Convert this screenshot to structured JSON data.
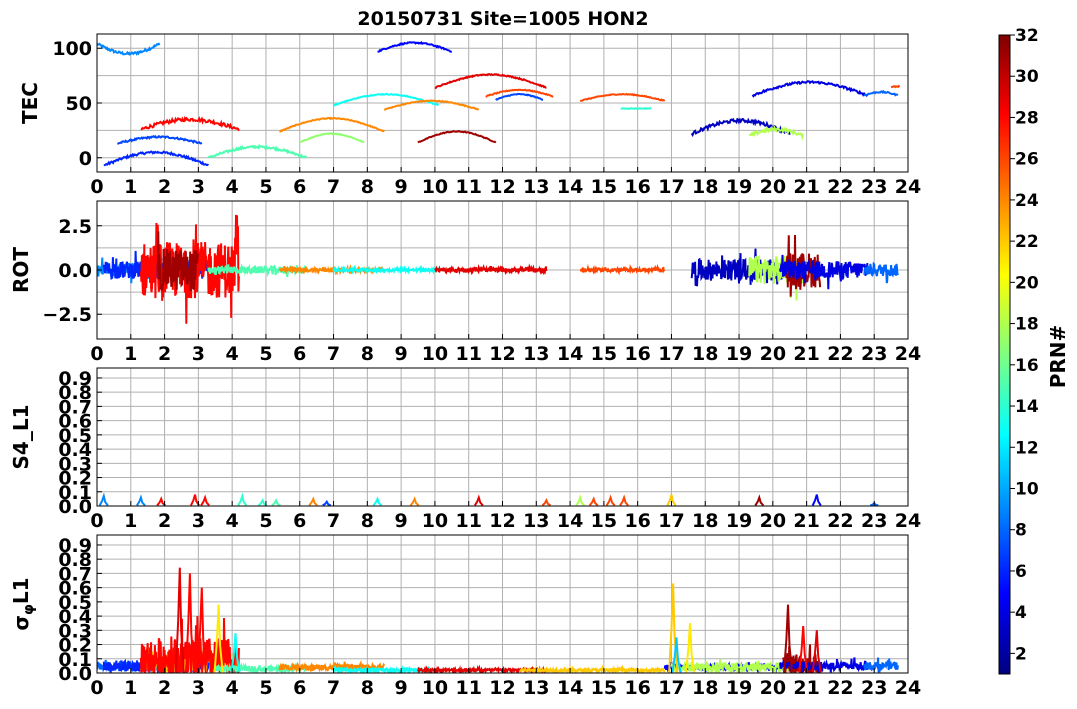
{
  "chart_data": {
    "type": "line",
    "title": "20150731 Site=1005 HON2",
    "x_ticks": [
      "0",
      "1",
      "2",
      "3",
      "4",
      "5",
      "6",
      "7",
      "8",
      "9",
      "10",
      "11",
      "12",
      "13",
      "14",
      "15",
      "16",
      "17",
      "18",
      "19",
      "20",
      "21",
      "22",
      "23",
      "24"
    ],
    "xlim": [
      0,
      24
    ],
    "grid": true,
    "colorbar": {
      "label": "PRN#",
      "range": [
        1,
        32
      ],
      "ticks": [
        "2",
        "4",
        "6",
        "8",
        "10",
        "12",
        "14",
        "16",
        "18",
        "20",
        "22",
        "24",
        "26",
        "28",
        "30",
        "32"
      ],
      "colors": [
        "#00007f",
        "#0000ff",
        "#007fff",
        "#00ffff",
        "#7fff7f",
        "#ffff00",
        "#ff7f00",
        "#ff0000",
        "#7f0000"
      ]
    },
    "panels": [
      {
        "ylabel": "TEC",
        "ylim": [
          -13,
          113
        ],
        "y_ticks": [
          {
            "v": 0,
            "t": "0"
          },
          {
            "v": 50,
            "t": "50"
          },
          {
            "v": 100,
            "t": "100"
          }
        ],
        "y_grid": [
          0,
          25,
          50,
          75,
          100
        ],
        "arcs": [
          {
            "prn": 9,
            "x0": 0.0,
            "x1": 1.85,
            "amp": -9,
            "base": 104,
            "noise": 1.2
          },
          {
            "prn": 6,
            "x0": 0.2,
            "x1": 3.3,
            "amp": 12,
            "base": -7,
            "noise": 1.0
          },
          {
            "prn": 7,
            "x0": 0.6,
            "x1": 3.1,
            "amp": 6,
            "base": 13,
            "noise": 0.8
          },
          {
            "prn": 28,
            "x0": 1.3,
            "x1": 4.2,
            "amp": 9,
            "base": 26,
            "noise": 1.5
          },
          {
            "prn": 15,
            "x0": 3.3,
            "x1": 6.2,
            "amp": 10,
            "base": 0,
            "noise": 1.0
          },
          {
            "prn": 24,
            "x0": 5.4,
            "x1": 8.5,
            "amp": 12,
            "base": 24,
            "noise": 0.4
          },
          {
            "prn": 17,
            "x0": 6.0,
            "x1": 7.9,
            "amp": 8,
            "base": 14,
            "noise": 0.4
          },
          {
            "prn": 13,
            "x0": 7.0,
            "x1": 10.1,
            "amp": 10,
            "base": 48,
            "noise": 0.4
          },
          {
            "prn": 5,
            "x0": 8.3,
            "x1": 10.5,
            "amp": 8,
            "base": 97,
            "noise": 0.6
          },
          {
            "prn": 24,
            "x0": 8.5,
            "x1": 11.3,
            "amp": 8,
            "base": 44,
            "noise": 0.4
          },
          {
            "prn": 31,
            "x0": 9.5,
            "x1": 11.8,
            "amp": 10,
            "base": 14,
            "noise": 0.4
          },
          {
            "prn": 29,
            "x0": 10.0,
            "x1": 13.3,
            "amp": 12,
            "base": 64,
            "noise": 0.5
          },
          {
            "prn": 26,
            "x0": 11.5,
            "x1": 13.5,
            "amp": 6,
            "base": 56,
            "noise": 0.4
          },
          {
            "prn": 7,
            "x0": 11.8,
            "x1": 13.2,
            "amp": 5,
            "base": 53,
            "noise": 0.4
          },
          {
            "prn": 26,
            "x0": 14.3,
            "x1": 16.8,
            "amp": 6,
            "base": 52,
            "noise": 0.4
          },
          {
            "prn": 14,
            "x0": 15.5,
            "x1": 16.4,
            "amp": 0,
            "base": 45,
            "noise": 0.3
          },
          {
            "prn": 3,
            "x0": 17.6,
            "x1": 20.5,
            "amp": 12,
            "base": 22,
            "noise": 1.5
          },
          {
            "prn": 18,
            "x0": 19.3,
            "x1": 20.9,
            "amp": 6,
            "base": 20,
            "noise": 1.5
          },
          {
            "prn": 4,
            "x0": 19.4,
            "x1": 22.8,
            "amp": 12,
            "base": 57,
            "noise": 1.0
          },
          {
            "prn": 8,
            "x0": 22.7,
            "x1": 23.7,
            "amp": 3,
            "base": 57,
            "noise": 0.6
          },
          {
            "prn": 26,
            "x0": 23.5,
            "x1": 23.75,
            "amp": 0,
            "base": 65,
            "noise": 0.5
          }
        ]
      },
      {
        "ylabel": "ROT",
        "ylim": [
          -3.9,
          3.9
        ],
        "y_ticks": [
          {
            "v": -2.5,
            "t": "−2.5"
          },
          {
            "v": 0,
            "t": "0.0"
          },
          {
            "v": 2.5,
            "t": "2.5"
          }
        ],
        "y_grid": [
          -2.5,
          -1.25,
          0,
          1.25,
          2.5
        ],
        "arcs": [
          {
            "prn": 9,
            "x0": 0.0,
            "x1": 1.9,
            "noise": 0.35
          },
          {
            "prn": 6,
            "x0": 0.2,
            "x1": 3.3,
            "noise": 0.5
          },
          {
            "prn": 28,
            "x0": 1.3,
            "x1": 4.2,
            "noise": 1.6
          },
          {
            "prn": 31,
            "x0": 1.8,
            "x1": 3.0,
            "noise": 1.2
          },
          {
            "prn": 15,
            "x0": 3.3,
            "x1": 6.2,
            "noise": 0.2
          },
          {
            "prn": 24,
            "x0": 5.4,
            "x1": 8.5,
            "noise": 0.1
          },
          {
            "prn": 13,
            "x0": 7.0,
            "x1": 10.1,
            "noise": 0.08
          },
          {
            "prn": 29,
            "x0": 10.0,
            "x1": 13.3,
            "noise": 0.1
          },
          {
            "prn": 26,
            "x0": 14.3,
            "x1": 16.8,
            "noise": 0.08
          },
          {
            "prn": 3,
            "x0": 17.6,
            "x1": 20.5,
            "noise": 0.6
          },
          {
            "prn": 18,
            "x0": 19.3,
            "x1": 20.9,
            "noise": 0.8
          },
          {
            "prn": 31,
            "x0": 20.4,
            "x1": 21.4,
            "noise": 1.0
          },
          {
            "prn": 4,
            "x0": 20.2,
            "x1": 22.8,
            "noise": 0.5
          },
          {
            "prn": 8,
            "x0": 22.7,
            "x1": 23.7,
            "noise": 0.35
          }
        ]
      },
      {
        "ylabel": "S4_L1",
        "ylim": [
          0,
          0.97
        ],
        "y_ticks": [
          {
            "v": 0,
            "t": "0.0"
          },
          {
            "v": 0.1,
            "t": "0.1"
          },
          {
            "v": 0.2,
            "t": "0.2"
          },
          {
            "v": 0.3,
            "t": "0.3"
          },
          {
            "v": 0.4,
            "t": "0.4"
          },
          {
            "v": 0.5,
            "t": "0.5"
          },
          {
            "v": 0.6,
            "t": "0.6"
          },
          {
            "v": 0.7,
            "t": "0.7"
          },
          {
            "v": 0.8,
            "t": "0.8"
          },
          {
            "v": 0.9,
            "t": "0.9"
          }
        ],
        "y_grid": [
          0.1,
          0.2,
          0.3,
          0.4,
          0.5,
          0.6,
          0.7,
          0.8,
          0.9
        ],
        "spikes": [
          {
            "prn": 9,
            "x": 0.2,
            "v": 0.07
          },
          {
            "prn": 9,
            "x": 1.3,
            "v": 0.06
          },
          {
            "prn": 28,
            "x": 1.9,
            "v": 0.05
          },
          {
            "prn": 28,
            "x": 2.9,
            "v": 0.08
          },
          {
            "prn": 28,
            "x": 3.2,
            "v": 0.06
          },
          {
            "prn": 14,
            "x": 4.3,
            "v": 0.07
          },
          {
            "prn": 14,
            "x": 4.9,
            "v": 0.04
          },
          {
            "prn": 15,
            "x": 5.3,
            "v": 0.04
          },
          {
            "prn": 24,
            "x": 6.4,
            "v": 0.05
          },
          {
            "prn": 7,
            "x": 6.8,
            "v": 0.03
          },
          {
            "prn": 13,
            "x": 8.3,
            "v": 0.05
          },
          {
            "prn": 24,
            "x": 9.4,
            "v": 0.05
          },
          {
            "prn": 29,
            "x": 11.3,
            "v": 0.06
          },
          {
            "prn": 26,
            "x": 13.3,
            "v": 0.04
          },
          {
            "prn": 18,
            "x": 14.3,
            "v": 0.06
          },
          {
            "prn": 26,
            "x": 14.7,
            "v": 0.05
          },
          {
            "prn": 26,
            "x": 15.2,
            "v": 0.06
          },
          {
            "prn": 26,
            "x": 15.6,
            "v": 0.06
          },
          {
            "prn": 22,
            "x": 17.0,
            "v": 0.08
          },
          {
            "prn": 31,
            "x": 19.6,
            "v": 0.06
          },
          {
            "prn": 5,
            "x": 21.3,
            "v": 0.08
          },
          {
            "prn": 8,
            "x": 23.0,
            "v": 0.02
          }
        ]
      },
      {
        "ylabel": "σφL1",
        "ylim": [
          0,
          0.97
        ],
        "y_ticks": [
          {
            "v": 0,
            "t": "0.0"
          },
          {
            "v": 0.1,
            "t": "0.1"
          },
          {
            "v": 0.2,
            "t": "0.2"
          },
          {
            "v": 0.3,
            "t": "0.3"
          },
          {
            "v": 0.4,
            "t": "0.4"
          },
          {
            "v": 0.5,
            "t": "0.5"
          },
          {
            "v": 0.6,
            "t": "0.6"
          },
          {
            "v": 0.7,
            "t": "0.7"
          },
          {
            "v": 0.8,
            "t": "0.8"
          },
          {
            "v": 0.9,
            "t": "0.9"
          }
        ],
        "y_grid": [
          0.1,
          0.2,
          0.3,
          0.4,
          0.5,
          0.6,
          0.7,
          0.8,
          0.9
        ],
        "arcs": [
          {
            "prn": 8,
            "x0": 0.0,
            "x1": 1.9,
            "base": 0.05,
            "noise": 0.03
          },
          {
            "prn": 6,
            "x0": 0.2,
            "x1": 3.3,
            "base": 0.05,
            "noise": 0.04
          },
          {
            "prn": 21,
            "x0": 1.3,
            "x1": 4.2,
            "base": 0.08,
            "noise": 0.08
          },
          {
            "prn": 28,
            "x0": 1.3,
            "x1": 4.2,
            "base": 0.1,
            "noise": 0.15
          },
          {
            "prn": 15,
            "x0": 3.5,
            "x1": 6.2,
            "base": 0.03,
            "noise": 0.02
          },
          {
            "prn": 24,
            "x0": 5.4,
            "x1": 8.5,
            "base": 0.04,
            "noise": 0.02
          },
          {
            "prn": 13,
            "x0": 7.0,
            "x1": 10.1,
            "base": 0.02,
            "noise": 0.01
          },
          {
            "prn": 29,
            "x0": 9.5,
            "x1": 13.3,
            "base": 0.02,
            "noise": 0.01
          },
          {
            "prn": 22,
            "x0": 12.5,
            "x1": 16.8,
            "base": 0.02,
            "noise": 0.01
          },
          {
            "prn": 5,
            "x0": 16.8,
            "x1": 20.5,
            "base": 0.04,
            "noise": 0.02
          },
          {
            "prn": 18,
            "x0": 17.0,
            "x1": 20.9,
            "base": 0.04,
            "noise": 0.03
          },
          {
            "prn": 31,
            "x0": 20.3,
            "x1": 21.4,
            "base": 0.06,
            "noise": 0.08
          },
          {
            "prn": 4,
            "x0": 20.2,
            "x1": 22.8,
            "base": 0.05,
            "noise": 0.03
          },
          {
            "prn": 8,
            "x0": 22.7,
            "x1": 23.7,
            "base": 0.05,
            "noise": 0.03
          }
        ],
        "spikes": [
          {
            "prn": 29,
            "x": 2.45,
            "v": 0.74
          },
          {
            "prn": 28,
            "x": 2.75,
            "v": 0.7
          },
          {
            "prn": 28,
            "x": 3.1,
            "v": 0.6
          },
          {
            "prn": 21,
            "x": 3.6,
            "v": 0.48
          },
          {
            "prn": 13,
            "x": 4.1,
            "v": 0.28
          },
          {
            "prn": 22,
            "x": 17.05,
            "v": 0.63
          },
          {
            "prn": 11,
            "x": 17.15,
            "v": 0.25
          },
          {
            "prn": 21,
            "x": 17.55,
            "v": 0.35
          },
          {
            "prn": 31,
            "x": 20.45,
            "v": 0.48
          },
          {
            "prn": 28,
            "x": 20.9,
            "v": 0.33
          },
          {
            "prn": 29,
            "x": 21.3,
            "v": 0.3
          }
        ]
      }
    ]
  }
}
